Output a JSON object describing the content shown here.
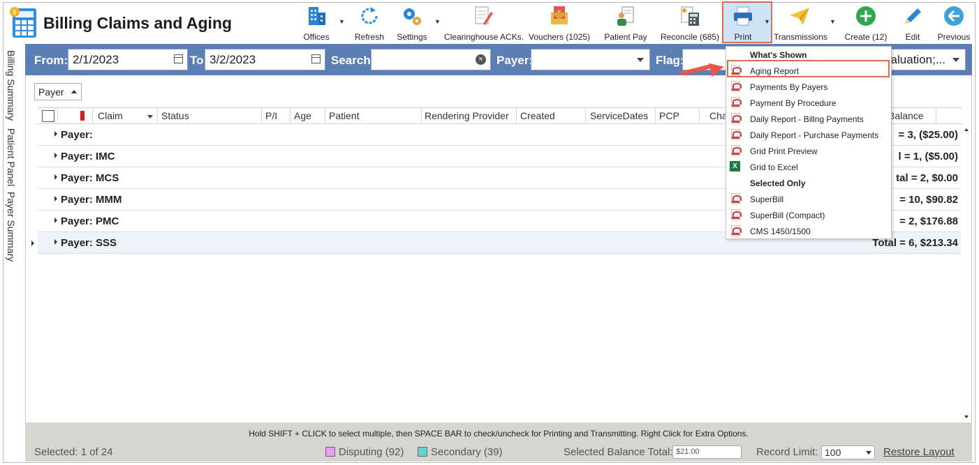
{
  "header": {
    "title": "Billing Claims and Aging"
  },
  "toolbar": {
    "offices": "Offices",
    "refresh": "Refresh",
    "settings": "Settings",
    "clearinghouse": "Clearinghouse ACKs.",
    "vouchers": "Vouchers (1025)",
    "patient_pay": "Patient Pay",
    "reconcile": "Reconcile (685)",
    "print": "Print",
    "transmissions": "Transmissions",
    "create": "Create (12)",
    "edit": "Edit",
    "previous": "Previous"
  },
  "filters": {
    "from_label": "From:",
    "from_value": "2/1/2023",
    "to_label": "To:",
    "to_value": "3/2/2023",
    "search_label": "Search:",
    "search_value": "",
    "payer_label": "Payer:",
    "payer_value": "",
    "flag_label": "Flag:",
    "flag_value": "valuation;..."
  },
  "side_tabs": [
    "Billing Summary",
    "Patient Panel",
    "Payer Summary"
  ],
  "group_panel": {
    "chip": "Payer"
  },
  "grid": {
    "columns": [
      "Claim",
      "Status",
      "P/I",
      "Age",
      "Patient",
      "Rendering Provider",
      "Created",
      "ServiceDates",
      "PCP",
      "Cha",
      "Balance"
    ],
    "rows": [
      {
        "label": "Payer:",
        "total": "= 3,  ($25.00)"
      },
      {
        "label": "Payer: IMC",
        "total": "l = 1,  ($5.00)"
      },
      {
        "label": "Payer: MCS",
        "total": "tal = 2,  $0.00"
      },
      {
        "label": "Payer: MMM",
        "total": "= 10,  $90.82"
      },
      {
        "label": "Payer: PMC",
        "total": "= 2,  $176.88"
      },
      {
        "label": "Payer: SSS",
        "total": "Total = 6,  $213.34"
      }
    ]
  },
  "print_menu": {
    "section1": "What's Shown",
    "items1": [
      "Aging Report",
      "Payments By Payers",
      "Payment By Procedure",
      "Daily Report - Billng Payments",
      "Daily Report - Purchase Payments",
      "Grid Print Preview",
      "Grid to Excel"
    ],
    "section2": "Selected Only",
    "items2": [
      "SuperBill",
      "SuperBill (Compact)",
      "CMS 1450/1500"
    ]
  },
  "footer": {
    "hint": "Hold SHIFT + CLICK to select multiple, then SPACE BAR to check/uncheck for Printing and Transmitting. Right Click for Extra Options.",
    "selected": "Selected: 1 of 24",
    "disputing": "Disputing (92)",
    "secondary": "Secondary (39)",
    "balance_label": "Selected Balance Total:",
    "balance_value": "$21.00",
    "record_limit_label": "Record Limit:",
    "record_limit_value": "100",
    "restore": "Restore Layout"
  },
  "colors": {
    "filter_bar": "#5b7fb5",
    "highlight": "#e06a4f",
    "disputing": "#e8a0f0",
    "secondary": "#5fd6cf"
  }
}
